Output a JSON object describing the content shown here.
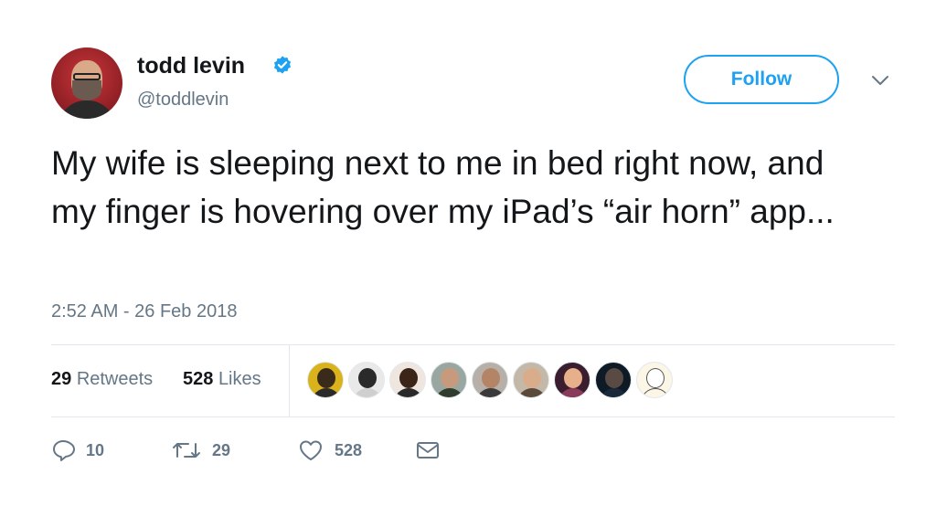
{
  "author": {
    "name": "todd levin",
    "handle": "@toddlevin",
    "verified": true
  },
  "follow_button": {
    "label": "Follow"
  },
  "tweet": {
    "text": "My wife is sleeping next to me in bed right now, and my finger is hovering over my iPad’s “air horn” app...",
    "timestamp": "2:52 AM - 26 Feb 2018"
  },
  "stats": {
    "retweets_count": "29",
    "retweets_label": "Retweets",
    "likes_count": "528",
    "likes_label": "Likes"
  },
  "actions": {
    "reply_count": "10",
    "retweet_count": "29",
    "like_count": "528"
  },
  "liker_avatars": [
    {
      "bg": "#d9b21c",
      "face": "#3a2a1a",
      "body": "#2b2b2b"
    },
    {
      "bg": "#e9e9e9",
      "face": "#2a2a2a",
      "body": "#cfcfcf"
    },
    {
      "bg": "#f0e6e0",
      "face": "#3b2418",
      "body": "#2a2a2a"
    },
    {
      "bg": "#9aa7a0",
      "face": "#c79a7e",
      "body": "#2f3d2f"
    },
    {
      "bg": "#b6b0a8",
      "face": "#b48466",
      "body": "#3a3a3a"
    },
    {
      "bg": "#c4b8a8",
      "face": "#d9ad8c",
      "body": "#5a4a3a"
    },
    {
      "bg": "#3a1e30",
      "face": "#e7b08a",
      "body": "#8a3a5a"
    },
    {
      "bg": "#0e1a26",
      "face": "#5a4a44",
      "body": "#1a2a3a"
    },
    {
      "bg": "#fbf6e6",
      "face": "#ffffff",
      "body": "#fbf6e6"
    }
  ],
  "colors": {
    "accent": "#1da1f2",
    "secondary_text": "#657786",
    "primary_text": "#14171a",
    "divider": "#e1e8ed"
  },
  "icons": {
    "verified": "verified-badge-icon",
    "caret": "chevron-down-icon",
    "reply": "reply-icon",
    "retweet": "retweet-icon",
    "like": "heart-icon",
    "dm": "envelope-icon"
  }
}
